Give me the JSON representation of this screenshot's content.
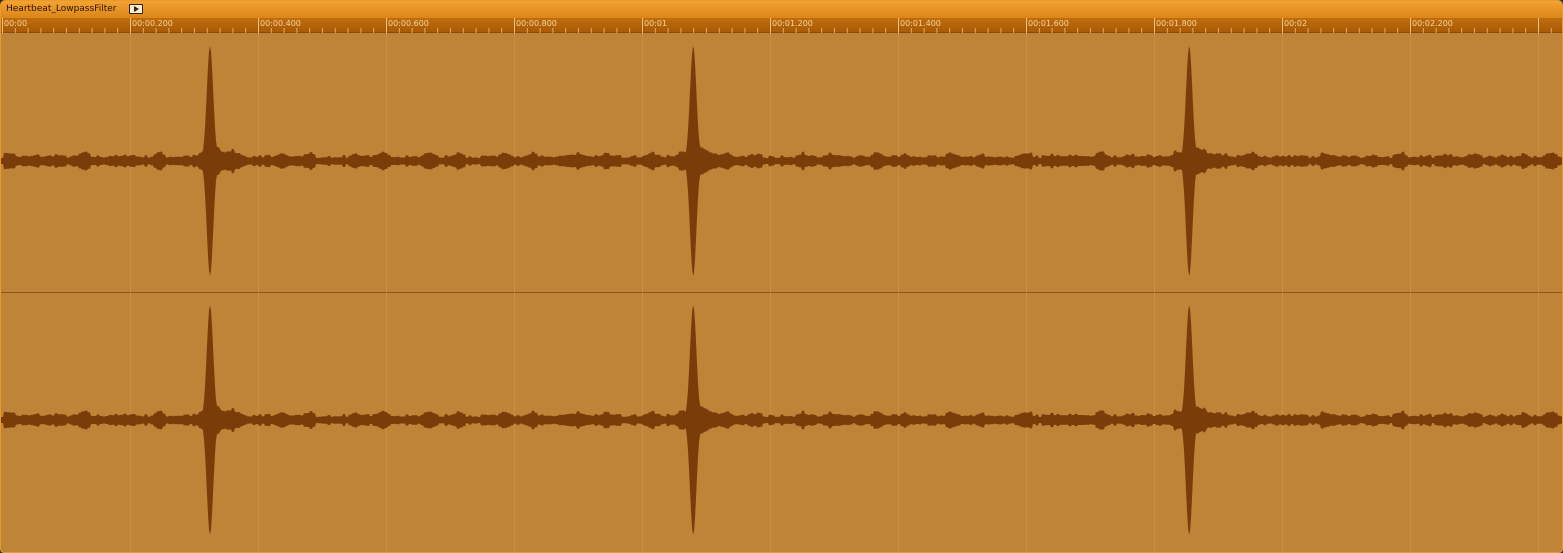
{
  "clip": {
    "name": "Heartbeat_LowpassFilter",
    "play_icon": "play-icon"
  },
  "ruler": {
    "labels": [
      "00:00",
      "00:00.200",
      "00:00.400",
      "00:00.600",
      "00:00.800",
      "00:01",
      "00:01.200",
      "00:01.400",
      "00:01.600",
      "00:01.800",
      "00:02",
      "00:02.200"
    ],
    "major_interval_seconds": 0.2,
    "minor_ticks_per_major": 10
  },
  "waveform": {
    "channels": 2,
    "beat_times_seconds": [
      0.325,
      1.08,
      1.855
    ],
    "visible_duration_seconds": 2.44
  },
  "colors": {
    "clip_background": "#bf8438",
    "waveform": "#7a3d0a",
    "titlebar_top": "#f4a233",
    "titlebar_bottom": "#da8618",
    "ruler": "#b4620a",
    "ruler_text": "#f6d49c",
    "gridline": "#cf9a55",
    "border": "#e89a2a"
  }
}
